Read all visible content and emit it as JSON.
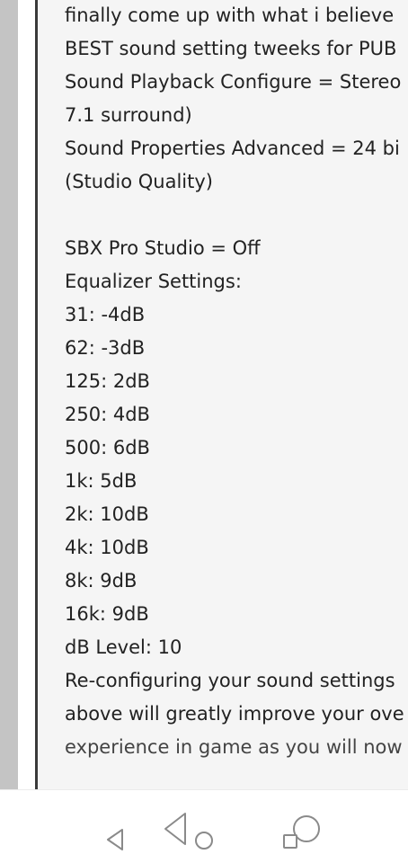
{
  "article": {
    "lines": [
      "finally come up with what i believe",
      "BEST sound setting tweeks for PUB",
      "Sound Playback Configure = Stereo",
      "7.1 surround)",
      "Sound Properties Advanced = 24 bi",
      "(Studio Quality)",
      "",
      "SBX Pro Studio = Off",
      "Equalizer Settings:",
      "31:  -4dB",
      "62:  -3dB",
      "125: 2dB",
      "250: 4dB",
      "500: 6dB",
      "1k:   5dB",
      "2k: 10dB",
      "4k: 10dB",
      "8k:   9dB",
      "16k: 9dB",
      "dB Level: 10",
      "Re-configuring your sound settings",
      "above will greatly improve your ove",
      "experience in game as you will now"
    ]
  },
  "nav": {
    "icons": [
      "back-icon",
      "home-icon",
      "recents-icon"
    ]
  },
  "colors": {
    "text": "#222222",
    "gutter": "#c4c4c4",
    "border": "#3a3a3a",
    "background": "#f5f5f5"
  }
}
